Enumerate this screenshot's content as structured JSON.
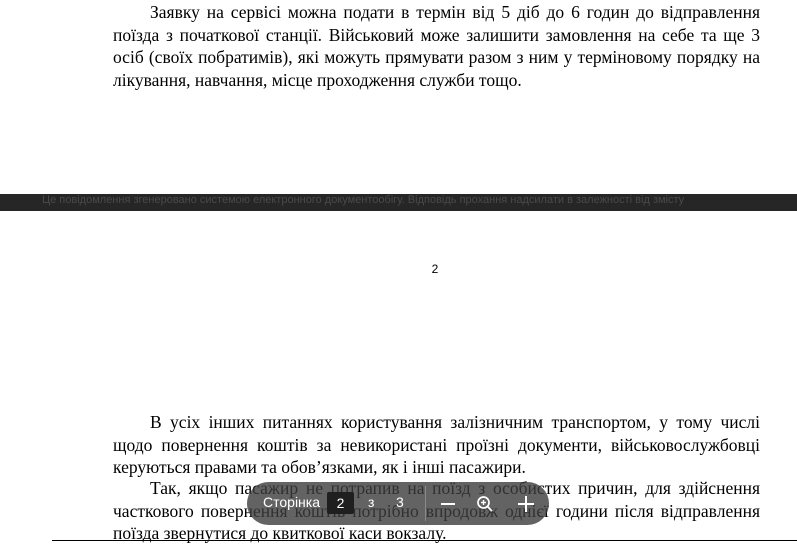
{
  "paragraphs": {
    "p1": "Заявку на сервісі можна подати в термін від 5 діб до 6 годин до відправлення поїзда з початкової станції. Військовий може залишити замовлення на себе та ще 3 осіб (своїх побратимів), які можуть прямувати разом з ним у терміновому порядку на лікування, навчання, місце проходження служби тощо.",
    "p2": "В усіх інших питаннях користування залізничним транспортом, у тому числі щодо повернення коштів за невикористані проїзні документи, військовослужбовці керуються правами та обов’язками, як і інші пасажири.",
    "p3": "Так, якщо пасажир не потрапив на поїзд з особистих причин, для здійснення часткового повернення коштів потрібно впродовж однієї години після відправлення поїзда звернутися до квиткової каси вокзалу."
  },
  "page_break": {
    "footer_text": "Це повідомлення згенеровано системою електронного документообігу. Відповідь прохання надсилати в залежності від змісту",
    "page_number": "2"
  },
  "toolbar": {
    "page_label": "Сторінка",
    "current_page": "2",
    "of_label": "з",
    "total_pages": "3",
    "zoom_out_icon": "minus-icon",
    "fit_icon": "zoom-fit-icon",
    "zoom_in_icon": "plus-icon"
  }
}
